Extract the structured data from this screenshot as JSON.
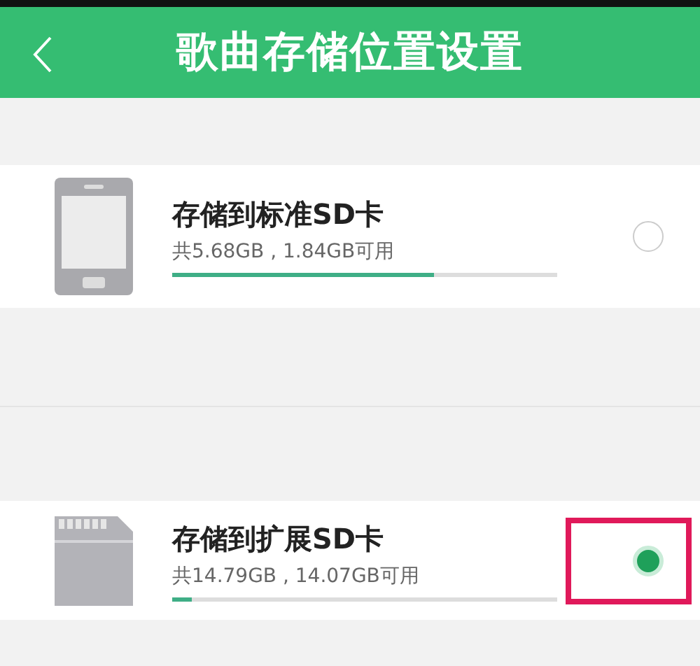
{
  "header": {
    "title": "歌曲存储位置设置"
  },
  "options": [
    {
      "kind": "phone",
      "title": "存储到标准SD卡",
      "usage": "共5.68GB , 1.84GB可用",
      "level": 0.68,
      "selected": false,
      "highlighted": false
    },
    {
      "kind": "sdcard",
      "title": "存储到扩展SD卡",
      "usage": "共14.79GB , 14.07GB可用",
      "level": 0.05,
      "selected": true,
      "highlighted": true
    }
  ]
}
